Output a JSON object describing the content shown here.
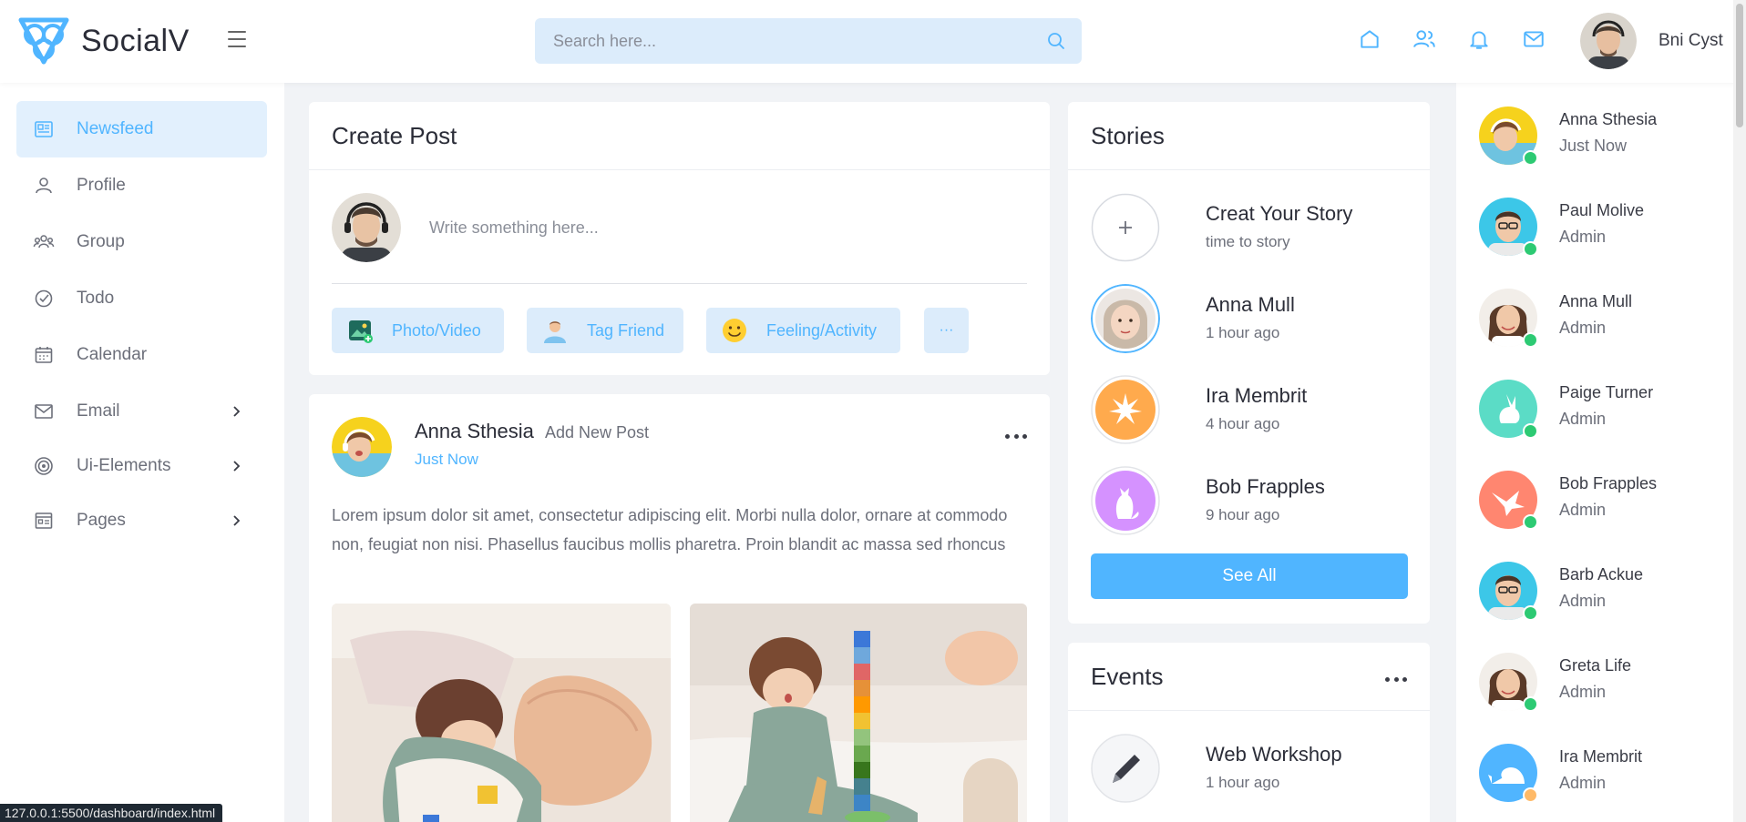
{
  "app": {
    "name": "SocialV"
  },
  "header": {
    "search_placeholder": "Search here...",
    "user_name": "Bni Cyst",
    "icons": [
      "home-icon",
      "friends-icon",
      "bell-icon",
      "mail-icon"
    ]
  },
  "sidebar": {
    "items": [
      {
        "label": "Newsfeed",
        "icon": "newsfeed-icon",
        "active": true
      },
      {
        "label": "Profile",
        "icon": "profile-icon"
      },
      {
        "label": "Group",
        "icon": "group-icon"
      },
      {
        "label": "Todo",
        "icon": "todo-icon"
      },
      {
        "label": "Calendar",
        "icon": "calendar-icon"
      },
      {
        "label": "Email",
        "icon": "email-icon",
        "has_submenu": true
      },
      {
        "label": "Ui-Elements",
        "icon": "ui-elements-icon",
        "has_submenu": true
      },
      {
        "label": "Pages",
        "icon": "pages-icon",
        "has_submenu": true
      }
    ]
  },
  "create_post": {
    "title": "Create Post",
    "placeholder": "Write something here...",
    "actions": [
      {
        "label": "Photo/Video",
        "icon": "photo-icon"
      },
      {
        "label": "Tag Friend",
        "icon": "tag-friend-icon"
      },
      {
        "label": "Feeling/Activity",
        "icon": "emoji-icon"
      },
      {
        "label": "···",
        "icon": "more-icon"
      }
    ]
  },
  "post": {
    "author": "Anna Sthesia",
    "action": "Add New Post",
    "time": "Just Now",
    "text": "Lorem ipsum dolor sit amet, consectetur adipiscing elit. Morbi nulla dolor, ornare at commodo non, feugiat non nisi. Phasellus faucibus mollis pharetra. Proin blandit ac massa sed rhoncus"
  },
  "stories": {
    "title": "Stories",
    "items": [
      {
        "name": "Creat Your Story",
        "time": "time to story"
      },
      {
        "name": "Anna Mull",
        "time": "1 hour ago"
      },
      {
        "name": "Ira Membrit",
        "time": "4 hour ago"
      },
      {
        "name": "Bob Frapples",
        "time": "9 hour ago"
      }
    ],
    "see_all": "See All"
  },
  "events": {
    "title": "Events",
    "items": [
      {
        "name": "Web Workshop",
        "time": "1 hour ago"
      }
    ]
  },
  "contacts": [
    {
      "name": "Anna Sthesia",
      "status": "Just Now",
      "online": "#2dca73"
    },
    {
      "name": "Paul Molive",
      "status": "Admin",
      "online": "#2dca73"
    },
    {
      "name": "Anna Mull",
      "status": "Admin",
      "online": "#2dca73"
    },
    {
      "name": "Paige Turner",
      "status": "Admin",
      "online": "#2dca73"
    },
    {
      "name": "Bob Frapples",
      "status": "Admin",
      "online": "#2dca73"
    },
    {
      "name": "Barb Ackue",
      "status": "Admin",
      "online": "#2dca73"
    },
    {
      "name": "Greta Life",
      "status": "Admin",
      "online": "#2dca73"
    },
    {
      "name": "Ira Membrit",
      "status": "Admin",
      "online": "#ffba68"
    }
  ],
  "statusbar": {
    "url": "127.0.0.1:5500/dashboard/index.html"
  },
  "colors": {
    "accent": "#50b5ff",
    "accent_light": "#dcecfb",
    "online": "#2dca73",
    "away": "#ffba68"
  }
}
